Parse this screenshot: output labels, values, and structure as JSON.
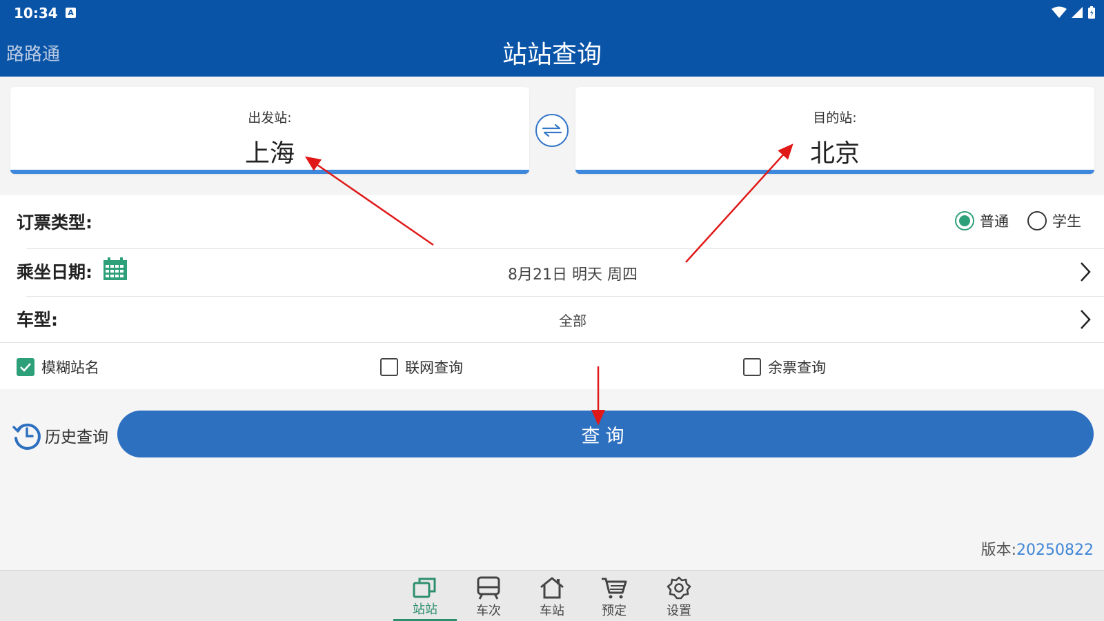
{
  "status_bar": {
    "time": "10:34",
    "keyboard_badge": "A"
  },
  "header": {
    "app_name": "路路通",
    "title": "站站查询"
  },
  "stations": {
    "from_label": "出发站:",
    "from_value": "上海",
    "to_label": "目的站:",
    "to_value": "北京",
    "swap_icon": "swap-icon"
  },
  "ticket_type": {
    "label": "订票类型:",
    "options": [
      {
        "label": "普通",
        "selected": true
      },
      {
        "label": "学生",
        "selected": false
      }
    ]
  },
  "date": {
    "label": "乘坐日期:",
    "value": "8月21日 明天 周四",
    "icon": "calendar-icon"
  },
  "train_type": {
    "label": "车型:",
    "value": "全部"
  },
  "checkboxes": [
    {
      "label": "模糊站名",
      "checked": true
    },
    {
      "label": "联网查询",
      "checked": false
    },
    {
      "label": "余票查询",
      "checked": false
    }
  ],
  "history": {
    "label": "历史查询",
    "icon": "history-icon"
  },
  "query_button": {
    "label": "查询"
  },
  "version": {
    "label": "版本:",
    "number": "20250822"
  },
  "tabs": [
    {
      "label": "站站",
      "icon": "station-to-station-icon",
      "active": true
    },
    {
      "label": "车次",
      "icon": "train-icon",
      "active": false
    },
    {
      "label": "车站",
      "icon": "home-icon",
      "active": false
    },
    {
      "label": "预定",
      "icon": "cart-icon",
      "active": false
    },
    {
      "label": "设置",
      "icon": "gear-icon",
      "active": false
    }
  ],
  "colors": {
    "header": "#0a54a8",
    "accent_blue": "#2e70c0",
    "accent_green": "#2da07a",
    "annotation_arrow": "#e01818"
  }
}
